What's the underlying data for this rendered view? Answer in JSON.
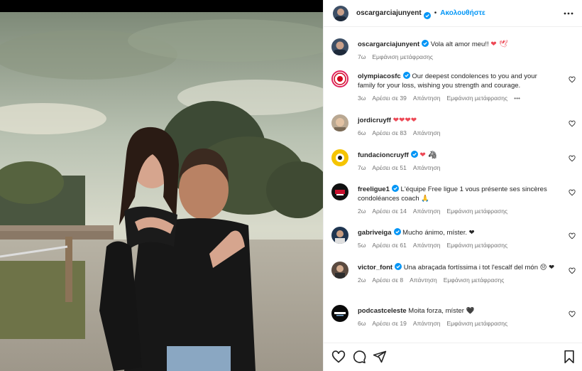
{
  "post": {
    "author": "oscargarciajunyent",
    "separator": "•",
    "follow_label": "Ακολουθήστε",
    "caption": {
      "username": "oscargarciajunyent",
      "text": "Vola alt amor meu!! ",
      "emoji": "❤ 🕊",
      "time": "7ω",
      "translate_label": "Εμφάνιση μετάφρασης"
    }
  },
  "comments": [
    {
      "username": "olympiacosfc",
      "text": "Our deepest condolences to you and your family for your loss, wishing you strength and courage.",
      "time": "3ω",
      "likes": "Αρέσει σε 39",
      "reply": "Απάντηση",
      "translate": "Εμφάνιση μετάφρασης",
      "more": "•••"
    },
    {
      "username": "jordicruyff",
      "text": "❤❤❤❤",
      "time": "6ω",
      "likes": "Αρέσει σε 83",
      "reply": "Απάντηση"
    },
    {
      "username": "fundacioncruyff",
      "text": "❤ 🦓",
      "time": "7ω",
      "likes": "Αρέσει σε 51",
      "reply": "Απάντηση"
    },
    {
      "username": "freeligue1",
      "text": "L'équipe Free ligue 1 vous présente ses sincères condoléances coach 🙏",
      "time": "2ω",
      "likes": "Αρέσει σε 14",
      "reply": "Απάντηση",
      "translate": "Εμφάνιση μετάφρασης"
    },
    {
      "username": "gabriveiga",
      "text": "Mucho ánimo, míster. ❤",
      "time": "5ω",
      "likes": "Αρέσει σε 61",
      "reply": "Απάντηση",
      "translate": "Εμφάνιση μετάφρασης"
    },
    {
      "username": "victor_font",
      "text": "Una abraçada fortíssima i tot l'escalf del món 😔 ❤",
      "time": "2ω",
      "likes": "Αρέσει σε 8",
      "reply": "Απάντηση",
      "translate": "Εμφάνιση μετάφρασης"
    },
    {
      "username": "podcastceleste",
      "text": "Moita forza, míster 🖤",
      "time": "6ω",
      "likes": "Αρέσει σε 19",
      "reply": "Απάντηση",
      "translate": "Εμφάνιση μετάφρασης"
    }
  ],
  "icons": {
    "like": "heart-icon",
    "comment": "comment-icon",
    "share": "share-icon",
    "save": "bookmark-icon",
    "more": "more-options-icon",
    "verified": "verified-badge-icon"
  },
  "colors": {
    "link": "#0095f6",
    "verified": "#0095f6",
    "secondary_text": "#737373",
    "heart_red": "#ed4956"
  }
}
